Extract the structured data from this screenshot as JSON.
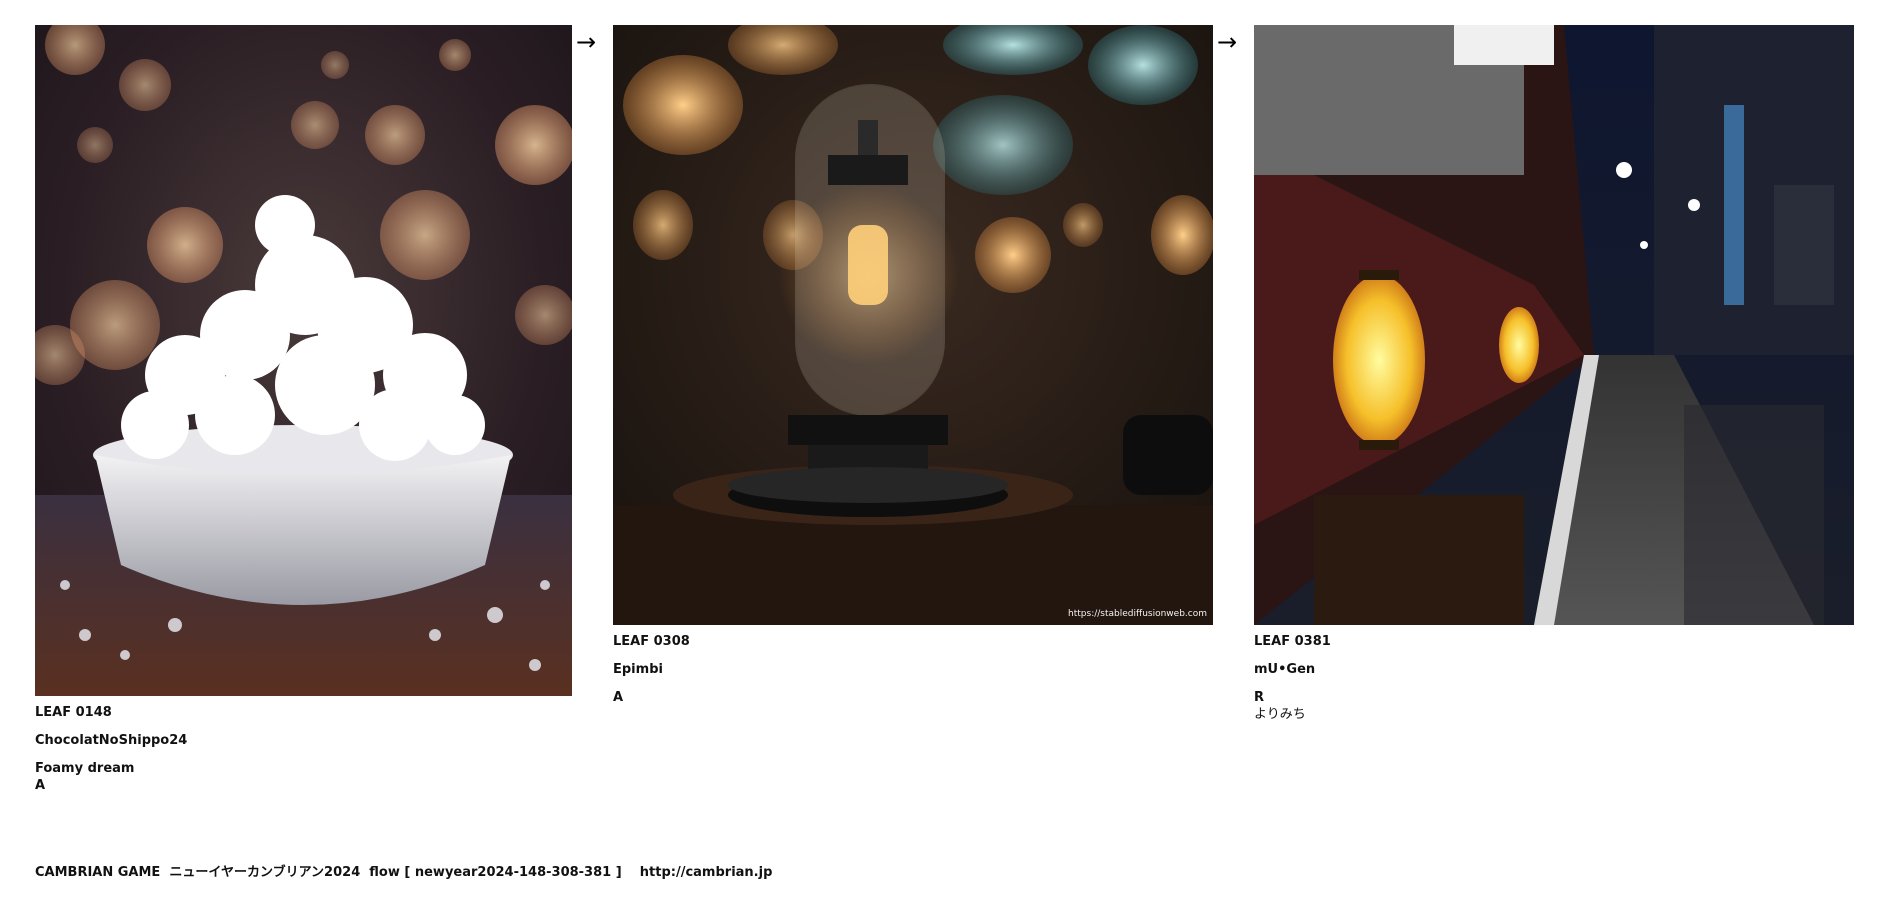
{
  "cards": [
    {
      "leaf_id": "LEAF 0148",
      "author": "ChocolatNoShippo24",
      "title": "Foamy dream",
      "rank": "A",
      "subtitle": ""
    },
    {
      "leaf_id": "LEAF 0308",
      "author": "Epimbi",
      "title": "A",
      "rank": "",
      "subtitle": "",
      "watermark": "https://stablediffusionweb.com"
    },
    {
      "leaf_id": "LEAF 0381",
      "author": "mU•Gen",
      "title": "R",
      "rank": "",
      "subtitle": "よりみち"
    }
  ],
  "arrows": [
    "→",
    "→"
  ],
  "footer": {
    "text": "CAMBRIAN GAME  ニューイヤーカンブリアン2024  flow [ newyear2024-148-308-381 ]    http://cambrian.jp"
  },
  "icons": {
    "arrow": "arrow-right-icon"
  }
}
